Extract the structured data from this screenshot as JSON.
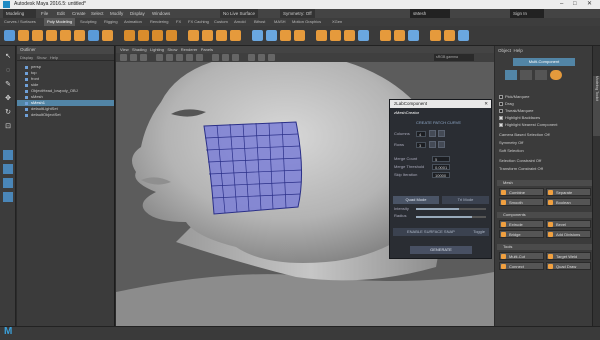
{
  "window": {
    "title": "Autodesk Maya 2016.5: untitled*",
    "mesh_field": "sMesh",
    "sign_in": "Sign In"
  },
  "menubar": {
    "workspace": "Modeling",
    "menus": [
      "File",
      "Edit",
      "Create",
      "Select",
      "Modify",
      "Display",
      "Windows",
      "Mesh",
      "Edit Mesh",
      "Mesh Tools",
      "Mesh Display",
      "Curves",
      "Surfaces",
      "Deform",
      "UV",
      "Generate",
      "Cache",
      "Help"
    ],
    "live_surface": "No Live Surface",
    "symmetry": "Symmetry: Off"
  },
  "shelf_tabs": [
    "Curves / Surfaces",
    "Poly Modeling",
    "Sculpting",
    "Rigging",
    "Animation",
    "Rendering",
    "FX",
    "FX Caching",
    "Custom",
    "Arnold",
    "Bifrost",
    "MASH",
    "Motion Graphics",
    "XGen"
  ],
  "shelf_active_index": 1,
  "outliner": {
    "title": "Outliner",
    "menu": [
      "Display",
      "Show",
      "Help"
    ],
    "items": [
      {
        "label": "persp",
        "selected": false
      },
      {
        "label": "top",
        "selected": false
      },
      {
        "label": "front",
        "selected": false
      },
      {
        "label": "side",
        "selected": false
      },
      {
        "label": "ObjectHead_lowpoly_OBJ",
        "selected": false
      },
      {
        "label": "sMesh",
        "selected": false
      },
      {
        "label": "sMesh1",
        "selected": true
      },
      {
        "label": "defaultLightSet",
        "selected": false
      },
      {
        "label": "defaultObjectSet",
        "selected": false
      }
    ]
  },
  "viewport": {
    "menu": [
      "View",
      "Shading",
      "Lighting",
      "Show",
      "Renderer",
      "Panels"
    ],
    "gamma": "sRGB gamma"
  },
  "dialog": {
    "title": "zLabComponent",
    "tab": "zMeshCreator",
    "subtitle": "CREATE PATCH CURVE",
    "rows": [
      {
        "label": "Columns",
        "value": "4"
      },
      {
        "label": "Rows",
        "value": "3"
      }
    ],
    "params": [
      {
        "label": "Merge Count",
        "value": "5"
      },
      {
        "label": "Merge Threshold",
        "value": "0.0001"
      },
      {
        "label": "Skip Iteration",
        "value": "10000"
      }
    ],
    "mode_a": "Quad Mode",
    "mode_b": "Tri Mode",
    "sliders": [
      {
        "label": "Intensity",
        "fill": 0.62
      },
      {
        "label": "Radius",
        "fill": 0.8
      }
    ],
    "toggle": "ENABLE SURFACE SNAP",
    "toggle_state": "Toggle",
    "create_button": "GENERATE"
  },
  "right_panel": {
    "tabs": [
      "Modeling Toolkit",
      "Object",
      "Help"
    ],
    "multi_component": "Multi-Component",
    "checks": [
      "Pick/Marquee",
      "Drag",
      "Tweak/Marquee",
      "Highlight Backfaces",
      "Highlight Nearest Component"
    ],
    "camera_based": "Camera Based Selection",
    "symmetry": "Symmetry",
    "soft_selection": "Soft Selection",
    "sel_constraint": "Selection Constraint",
    "transform_constraint": "Transform Constraint",
    "off": "Off",
    "sections": [
      "Mesh",
      "Components",
      "Tools"
    ],
    "mesh_buttons": [
      "Combine",
      "Separate",
      "Smooth",
      "Boolean"
    ],
    "component_buttons": [
      "Extrude",
      "Bevel",
      "Bridge",
      "Add Divisions"
    ],
    "tool_buttons": [
      "Multi-Cut",
      "Target Weld",
      "Connect",
      "Quad Draw"
    ]
  },
  "colors": {
    "accent_orange": "#f0a040",
    "selection_blue": "#5285a6",
    "mesh_patch": "#7b7fd6"
  }
}
